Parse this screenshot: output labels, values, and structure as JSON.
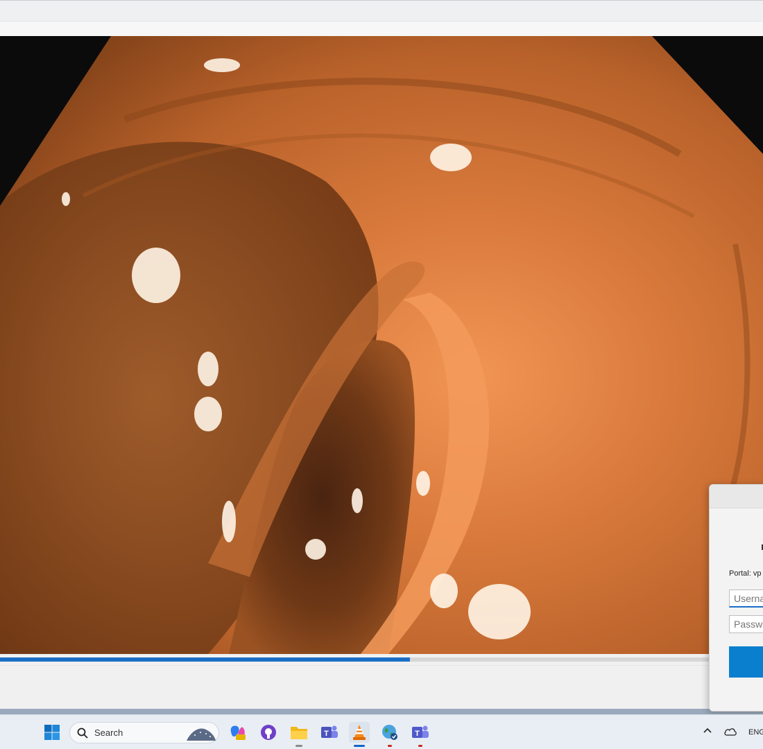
{
  "player": {
    "progress_fraction": 0.537
  },
  "vpn_dialog": {
    "portal_label": "Portal: vp",
    "username_placeholder": "Username",
    "password_placeholder": "Password",
    "accent_color": "#0a7fce"
  },
  "taskbar": {
    "search_label": "Search",
    "pinned": [
      "windows-start-icon",
      "copilot-icon",
      "github-icon",
      "file-explorer-icon",
      "teams-icon",
      "vlc-icon",
      "vpn-globe-icon",
      "teams-classic-icon"
    ],
    "tray_language": "ENG"
  }
}
